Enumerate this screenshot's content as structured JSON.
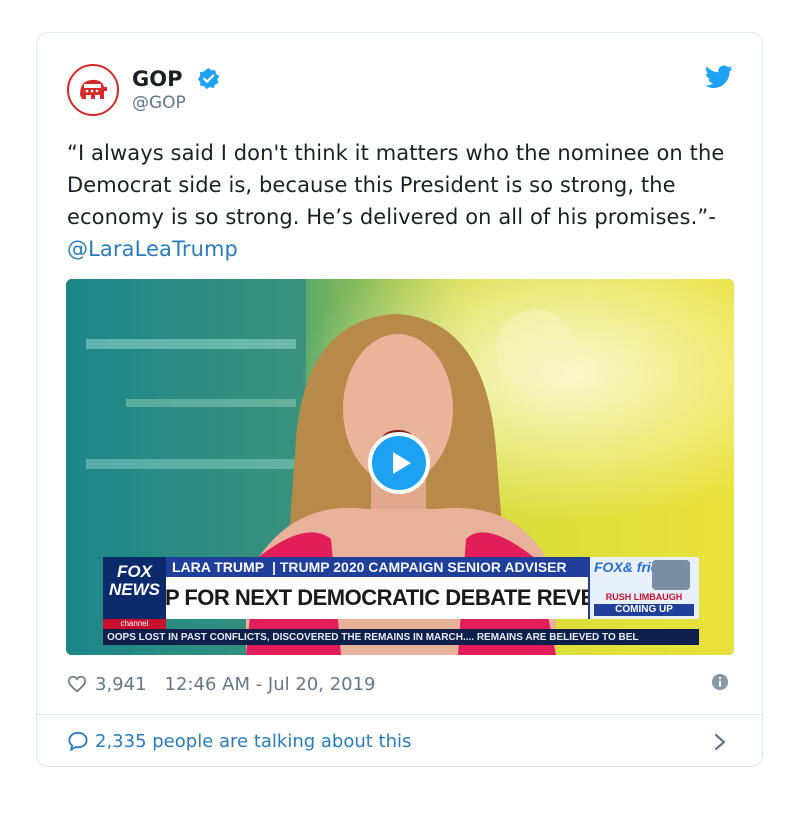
{
  "account": {
    "name": "GOP",
    "handle": "@GOP"
  },
  "tweet": {
    "text": "“I always said I don't think it matters who the nominee on the Democrat side is, because this President is so strong, the economy is so strong. He’s delivered on all of his promises.”-",
    "mention": "@LaraLeaTrump"
  },
  "video": {
    "lower_third_name": "LARA TRUMP",
    "lower_third_title": "| TRUMP 2020 CAMPAIGN SENIOR ADVISER",
    "headline": "LINEUP FOR NEXT DEMOCRATIC DEBATE REVEALED",
    "network_logo": "FOX NEWS",
    "network_channel": "channel",
    "crawl": "OOPS LOST IN PAST CONFLICTS, DISCOVERED THE REMAINS IN MARCH....   REMAINS ARE BELIEVED TO BEL",
    "show_logo": "FOX& friends",
    "promo_name": "RUSH LIMBAUGH",
    "promo_status": "COMING UP"
  },
  "meta": {
    "likes": "3,941",
    "timestamp": "12:46 AM - Jul 20, 2019"
  },
  "footer": {
    "talking": "2,335 people are talking about this"
  },
  "colors": {
    "accent": "#1da1f2",
    "link": "#2b7bb9",
    "muted": "#657786",
    "gop_red": "#d42a2a"
  },
  "icons": [
    "gop-elephant-icon",
    "verified-badge-icon",
    "twitter-bird-icon",
    "play-icon",
    "heart-icon",
    "info-icon",
    "comment-bubble-icon",
    "chevron-right-icon"
  ]
}
